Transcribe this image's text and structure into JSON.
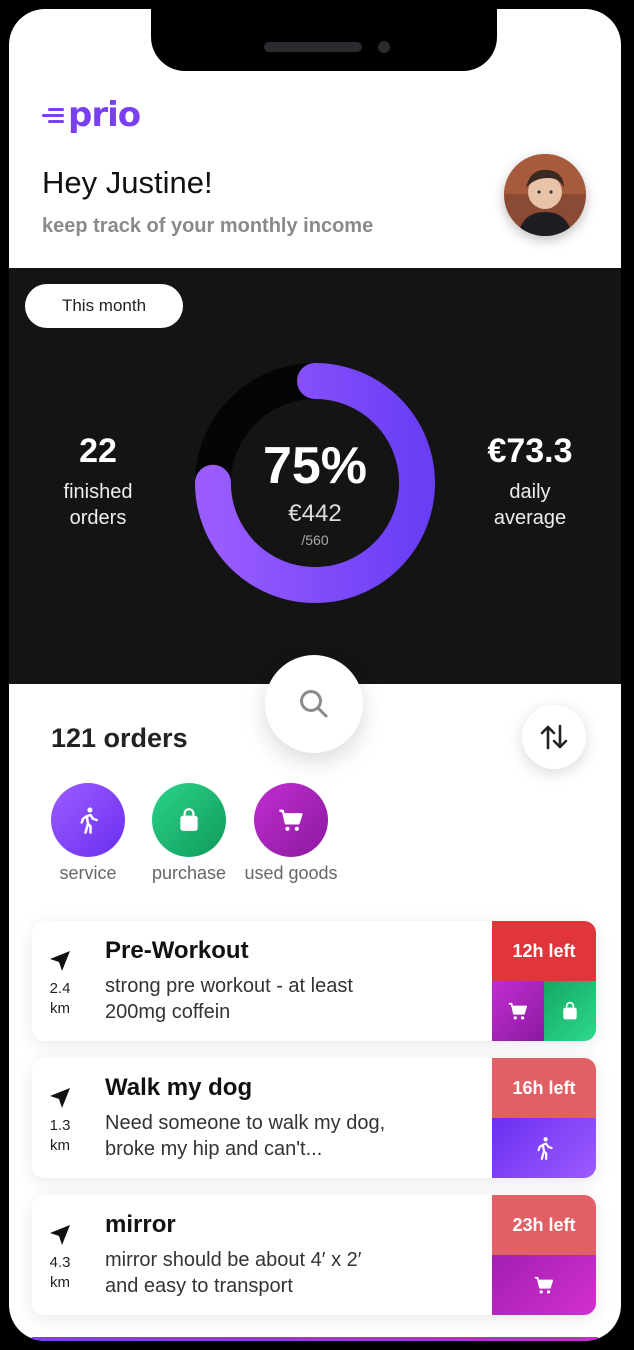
{
  "app": {
    "logo": "prio"
  },
  "header": {
    "greeting": "Hey Justine!",
    "subtitle": "keep track of your monthly income"
  },
  "summary": {
    "period": "This month",
    "finished_orders": {
      "value": "22",
      "label_line1": "finished",
      "label_line2": "orders"
    },
    "progress": {
      "percent": "75%",
      "amount": "€442",
      "goal": "/560",
      "fraction": 0.75
    },
    "daily_average": {
      "value": "€73.3",
      "label_line1": "daily",
      "label_line2": "average"
    }
  },
  "orders": {
    "count_label": "121 orders",
    "categories": [
      {
        "label": "service",
        "icon": "walking-icon"
      },
      {
        "label": "purchase",
        "icon": "bag-icon"
      },
      {
        "label": "used goods",
        "icon": "cart-icon"
      }
    ],
    "items": [
      {
        "title": "Pre-Workout",
        "desc_line1": "strong pre workout - at least",
        "desc_line2": "200mg coffein",
        "distance": "2.4",
        "unit": "km",
        "time_left": "12h left",
        "tags": [
          "cart-icon",
          "bag-icon"
        ]
      },
      {
        "title": "Walk my dog",
        "desc_line1": "Need someone to walk my dog,",
        "desc_line2": "broke my hip and can't...",
        "distance": "1.3",
        "unit": "km",
        "time_left": "16h left",
        "tags": [
          "walking-icon"
        ]
      },
      {
        "title": "mirror",
        "desc_line1": "mirror should be about 4′ x 2′",
        "desc_line2": "and easy to transport",
        "distance": "4.3",
        "unit": "km",
        "time_left": "23h left",
        "tags": [
          "cart-icon"
        ]
      }
    ]
  },
  "colors": {
    "brand": "#7b3ff2",
    "service": "#7b3ff2",
    "purchase": "#1fb86a",
    "used_goods": "#a21fb2",
    "urgent": "#e0353a",
    "soon": "#e06066"
  }
}
